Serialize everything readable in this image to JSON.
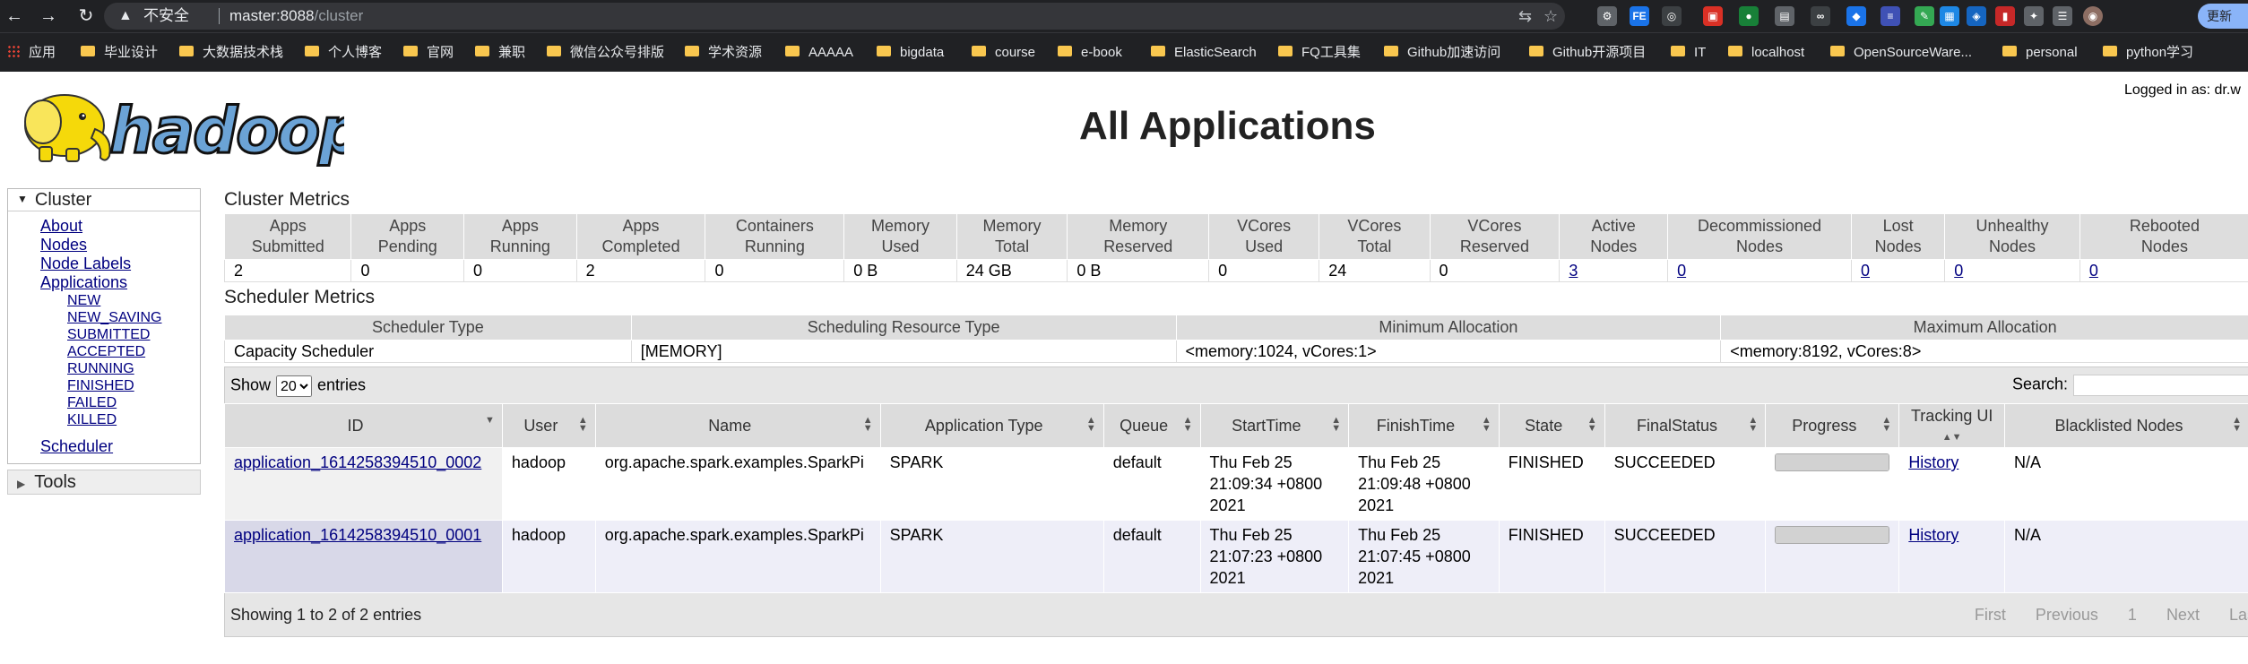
{
  "browser": {
    "security_label": "不安全",
    "url_host": "master:8088",
    "url_path": "/cluster",
    "update_label": "更新"
  },
  "bookmarks": [
    {
      "label": "应用",
      "icon": "apps-grid-icon"
    },
    {
      "label": "毕业设计",
      "icon": "folder-icon"
    },
    {
      "label": "大数据技术栈",
      "icon": "folder-icon"
    },
    {
      "label": "个人博客",
      "icon": "folder-icon"
    },
    {
      "label": "官网",
      "icon": "folder-icon"
    },
    {
      "label": "兼职",
      "icon": "folder-icon"
    },
    {
      "label": "微信公众号排版",
      "icon": "folder-icon"
    },
    {
      "label": "学术资源",
      "icon": "folder-icon"
    },
    {
      "label": "AAAAA",
      "icon": "folder-icon"
    },
    {
      "label": "bigdata",
      "icon": "folder-icon"
    },
    {
      "label": "course",
      "icon": "folder-icon"
    },
    {
      "label": "e-book",
      "icon": "folder-icon"
    },
    {
      "label": "ElasticSearch",
      "icon": "folder-icon"
    },
    {
      "label": "FQ工具集",
      "icon": "folder-icon"
    },
    {
      "label": "Github加速访问",
      "icon": "folder-icon"
    },
    {
      "label": "Github开源项目",
      "icon": "folder-icon"
    },
    {
      "label": "IT",
      "icon": "folder-icon"
    },
    {
      "label": "localhost",
      "icon": "folder-icon"
    },
    {
      "label": "OpenSourceWare...",
      "icon": "folder-icon"
    },
    {
      "label": "personal",
      "icon": "folder-icon"
    },
    {
      "label": "python学习",
      "icon": "folder-icon"
    }
  ],
  "header": {
    "logo_text": "hadoop",
    "title": "All Applications",
    "logged_in": "Logged in as: dr.w"
  },
  "sidebar": {
    "cluster_label": "Cluster",
    "links": [
      "About",
      "Nodes",
      "Node Labels",
      "Applications"
    ],
    "app_states": [
      "NEW",
      "NEW_SAVING",
      "SUBMITTED",
      "ACCEPTED",
      "RUNNING",
      "FINISHED",
      "FAILED",
      "KILLED"
    ],
    "scheduler_label": "Scheduler",
    "tools_label": "Tools"
  },
  "cluster_metrics": {
    "title": "Cluster Metrics",
    "headers": [
      [
        "Apps",
        "Submitted"
      ],
      [
        "Apps",
        "Pending"
      ],
      [
        "Apps",
        "Running"
      ],
      [
        "Apps",
        "Completed"
      ],
      [
        "Containers",
        "Running"
      ],
      [
        "Memory",
        "Used"
      ],
      [
        "Memory",
        "Total"
      ],
      [
        "Memory",
        "Reserved"
      ],
      [
        "VCores",
        "Used"
      ],
      [
        "VCores",
        "Total"
      ],
      [
        "VCores",
        "Reserved"
      ],
      [
        "Active",
        "Nodes"
      ],
      [
        "Decommissioned",
        "Nodes"
      ],
      [
        "Lost",
        "Nodes"
      ],
      [
        "Unhealthy",
        "Nodes"
      ],
      [
        "Rebooted",
        "Nodes"
      ]
    ],
    "values": [
      "2",
      "0",
      "0",
      "2",
      "0",
      "0 B",
      "24 GB",
      "0 B",
      "0",
      "24",
      "0",
      "3",
      "0",
      "0",
      "0",
      "0"
    ]
  },
  "scheduler_metrics": {
    "title": "Scheduler Metrics",
    "headers": [
      "Scheduler Type",
      "Scheduling Resource Type",
      "Minimum Allocation",
      "Maximum Allocation"
    ],
    "values": [
      "Capacity Scheduler",
      "[MEMORY]",
      "<memory:1024, vCores:1>",
      "<memory:8192, vCores:8>"
    ]
  },
  "apps_table": {
    "show_label": "Show",
    "entries_value": "20",
    "entries_label": "entries",
    "search_label": "Search:",
    "search_value": "",
    "columns": [
      "ID",
      "User",
      "Name",
      "Application Type",
      "Queue",
      "StartTime",
      "FinishTime",
      "State",
      "FinalStatus",
      "Progress",
      "Tracking UI",
      "Blacklisted Nodes"
    ],
    "rows": [
      {
        "id": "application_1614258394510_0002",
        "user": "hadoop",
        "name": "org.apache.spark.examples.SparkPi",
        "type": "SPARK",
        "queue": "default",
        "start": "Thu Feb 25 21:09:34 +0800 2021",
        "finish": "Thu Feb 25 21:09:48 +0800 2021",
        "state": "FINISHED",
        "final_status": "SUCCEEDED",
        "progress": 1.0,
        "tracking": "History",
        "blacklisted": "N/A"
      },
      {
        "id": "application_1614258394510_0001",
        "user": "hadoop",
        "name": "org.apache.spark.examples.SparkPi",
        "type": "SPARK",
        "queue": "default",
        "start": "Thu Feb 25 21:07:23 +0800 2021",
        "finish": "Thu Feb 25 21:07:45 +0800 2021",
        "state": "FINISHED",
        "final_status": "SUCCEEDED",
        "progress": 1.0,
        "tracking": "History",
        "blacklisted": "N/A"
      }
    ],
    "info": "Showing 1 to 2 of 2 entries",
    "pager": [
      "First",
      "Previous",
      "1",
      "Next",
      "Last"
    ]
  },
  "colors": {
    "link": "#000080",
    "logo_yellow": "#f5d90a",
    "logo_blue": "#6ba3d6"
  }
}
